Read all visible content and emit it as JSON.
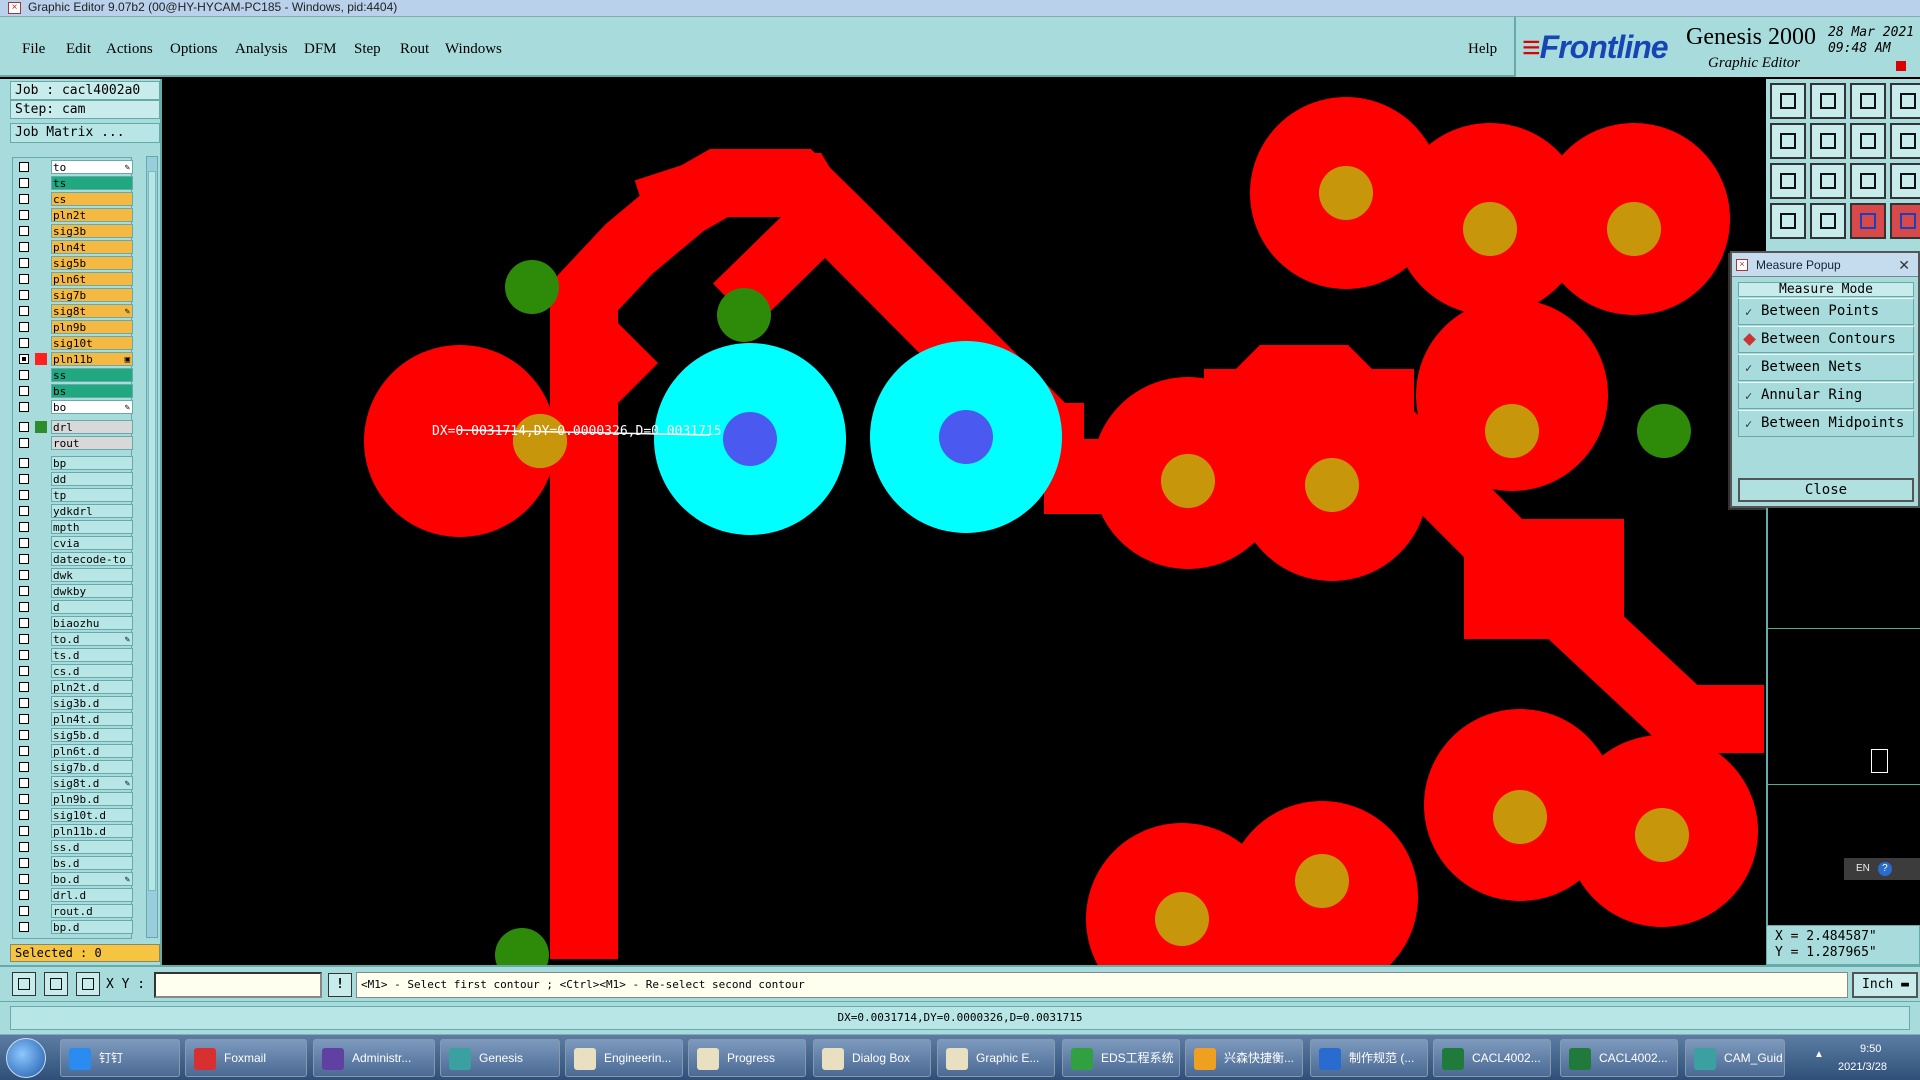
{
  "window": {
    "title": "Graphic Editor 9.07b2 (00@HY-HYCAM-PC185 - Windows, pid:4404)"
  },
  "menu": {
    "items": [
      "File",
      "Edit",
      "Actions",
      "Options",
      "Analysis",
      "DFM",
      "Step",
      "Rout",
      "Windows"
    ],
    "help": "Help"
  },
  "brand": {
    "logo": "Frontline",
    "product": "Genesis 2000",
    "subtitle": "Graphic Editor",
    "date": "28 Mar 2021",
    "time": "09:48 AM"
  },
  "job": {
    "job": "Job : cacl4002a0",
    "step": "Step: cam",
    "matrix": "Job Matrix ..."
  },
  "layers": {
    "board": [
      {
        "name": "to",
        "color": "#ffffff",
        "mark": "✎"
      },
      {
        "name": "ts",
        "color": "#20a880",
        "mark": ""
      },
      {
        "name": "cs",
        "color": "#f5b942",
        "mark": ""
      },
      {
        "name": "pln2t",
        "color": "#f5b942",
        "mark": ""
      },
      {
        "name": "sig3b",
        "color": "#f5b942",
        "mark": ""
      },
      {
        "name": "pln4t",
        "color": "#f5b942",
        "mark": ""
      },
      {
        "name": "sig5b",
        "color": "#f5b942",
        "mark": ""
      },
      {
        "name": "pln6t",
        "color": "#f5b942",
        "mark": ""
      },
      {
        "name": "sig7b",
        "color": "#f5b942",
        "mark": ""
      },
      {
        "name": "sig8t",
        "color": "#f5b942",
        "mark": "✎"
      },
      {
        "name": "pln9b",
        "color": "#f5b942",
        "mark": ""
      },
      {
        "name": "sig10t",
        "color": "#f5b942",
        "mark": ""
      },
      {
        "name": "pln11b",
        "color": "#f5b942",
        "mark": "▣",
        "active": true,
        "swatch": "#ff2020"
      },
      {
        "name": "ss",
        "color": "#20a880",
        "mark": ""
      },
      {
        "name": "bs",
        "color": "#20a880",
        "mark": ""
      },
      {
        "name": "bo",
        "color": "#ffffff",
        "mark": "✎"
      }
    ],
    "drill": [
      {
        "name": "drl",
        "color": "#d8d8d8",
        "mark": "",
        "swatch": "#2e8b2e"
      },
      {
        "name": "rout",
        "color": "#d8d8d8",
        "mark": ""
      }
    ],
    "misc": [
      {
        "name": "bp",
        "mark": ""
      },
      {
        "name": "dd",
        "mark": ""
      },
      {
        "name": "tp",
        "mark": ""
      },
      {
        "name": "ydkdrl",
        "mark": ""
      },
      {
        "name": "mpth",
        "mark": ""
      },
      {
        "name": "cvia",
        "mark": ""
      },
      {
        "name": "datecode-to",
        "mark": ""
      },
      {
        "name": "dwk",
        "mark": ""
      },
      {
        "name": "dwkby",
        "mark": ""
      },
      {
        "name": "d",
        "mark": ""
      },
      {
        "name": "biaozhu",
        "mark": ""
      },
      {
        "name": "to.d",
        "mark": "✎"
      },
      {
        "name": "ts.d",
        "mark": ""
      },
      {
        "name": "cs.d",
        "mark": ""
      },
      {
        "name": "pln2t.d",
        "mark": ""
      },
      {
        "name": "sig3b.d",
        "mark": ""
      },
      {
        "name": "pln4t.d",
        "mark": ""
      },
      {
        "name": "sig5b.d",
        "mark": ""
      },
      {
        "name": "pln6t.d",
        "mark": ""
      },
      {
        "name": "sig7b.d",
        "mark": ""
      },
      {
        "name": "sig8t.d",
        "mark": "✎"
      },
      {
        "name": "pln9b.d",
        "mark": ""
      },
      {
        "name": "sig10t.d",
        "mark": ""
      },
      {
        "name": "pln11b.d",
        "mark": ""
      },
      {
        "name": "ss.d",
        "mark": ""
      },
      {
        "name": "bs.d",
        "mark": ""
      },
      {
        "name": "bo.d",
        "mark": "✎"
      },
      {
        "name": "drl.d",
        "mark": ""
      },
      {
        "name": "rout.d",
        "mark": ""
      },
      {
        "name": "bp.d",
        "mark": ""
      }
    ],
    "misc_color": "#b8e6e6"
  },
  "selected": "Selected : 0",
  "canvas": {
    "measure_label": "DX=0.0031714,DY=0.0000326,D=0.0031715"
  },
  "colors": {
    "copper": "#ff0000",
    "pad_center": "#c8960a",
    "drill": "#2e8b0a",
    "highlight": "#00ffff",
    "highlight_center": "#4a5af0"
  },
  "measure_popup": {
    "title": "Measure Popup",
    "header": "Measure Mode",
    "options": [
      {
        "label": "Between Points",
        "selected": false
      },
      {
        "label": "Between Contours",
        "selected": true
      },
      {
        "label": "Between Nets",
        "selected": false
      },
      {
        "label": "Annular Ring",
        "selected": false
      },
      {
        "label": "Between Midpoints",
        "selected": false
      }
    ],
    "close": "Close"
  },
  "coords": {
    "x": "X = 2.484587\"",
    "y": "Y = 1.287965\""
  },
  "lang": {
    "code": "EN"
  },
  "cmd": {
    "xy_label": "X Y :",
    "xy_value": "",
    "prompt": "<M1> - Select first contour ; <Ctrl><M1> - Re-select second contour",
    "unit": "Inch"
  },
  "status": {
    "text": "DX=0.0031714,DY=0.0000326,D=0.0031715"
  },
  "taskbar": {
    "items": [
      {
        "label": "钉钉",
        "icon": "#2a8cf0"
      },
      {
        "label": "Foxmail",
        "icon": "#d83030"
      },
      {
        "label": "Administr...",
        "icon": "#6040a0"
      },
      {
        "label": "Genesis",
        "icon": "#3aa0a0"
      },
      {
        "label": "Engineerin...",
        "icon": "#e8e0c0"
      },
      {
        "label": "Progress",
        "icon": "#e8e0c0"
      },
      {
        "label": "Dialog Box",
        "icon": "#e8e0c0"
      },
      {
        "label": "Graphic E...",
        "icon": "#e8e0c0"
      },
      {
        "label": "EDS工程系统",
        "icon": "#30a040"
      },
      {
        "label": "兴森快捷衡...",
        "icon": "#f0a020"
      },
      {
        "label": "制作规范 (...",
        "icon": "#2a6bd0"
      },
      {
        "label": "CACL4002...",
        "icon": "#1f7a3c"
      },
      {
        "label": "CACL4002...",
        "icon": "#1f7a3c"
      },
      {
        "label": "CAM_Guid...",
        "icon": "#3aa0a0"
      }
    ],
    "time": "9:50",
    "date": "2021/3/28"
  }
}
